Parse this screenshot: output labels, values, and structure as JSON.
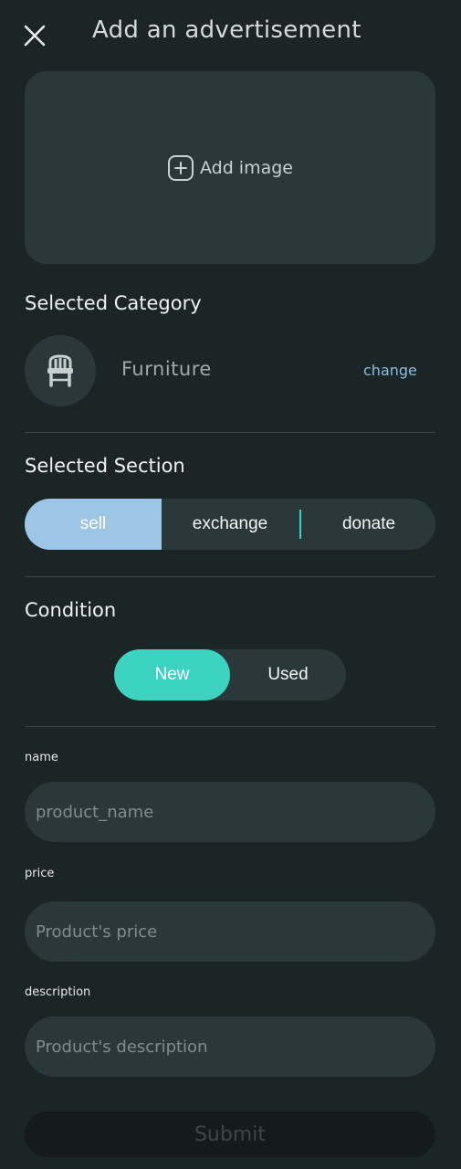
{
  "header": {
    "title": "Add an advertisement",
    "close_icon": "close-icon"
  },
  "image_upload": {
    "label": "Add image",
    "icon": "add-box-icon"
  },
  "category": {
    "heading": "Selected Category",
    "name": "Furniture",
    "icon": "chair-icon",
    "change_label": "change"
  },
  "section": {
    "heading": "Selected Section",
    "options": [
      "sell",
      "exchange",
      "donate"
    ],
    "selected": "sell"
  },
  "condition": {
    "heading": "Condition",
    "options": [
      "New",
      "Used"
    ],
    "selected": "New"
  },
  "form": {
    "name_label": "name",
    "name_placeholder": "product_name",
    "price_label": "price",
    "price_placeholder": "Product's price",
    "description_label": "description",
    "description_placeholder": "Product's description"
  },
  "submit_label": "Submit",
  "colors": {
    "background": "#1c2526",
    "surface": "#2a3839",
    "accent_teal": "#3dd3c1",
    "accent_blue": "#9cc5e6",
    "link": "#8dbcdd"
  }
}
